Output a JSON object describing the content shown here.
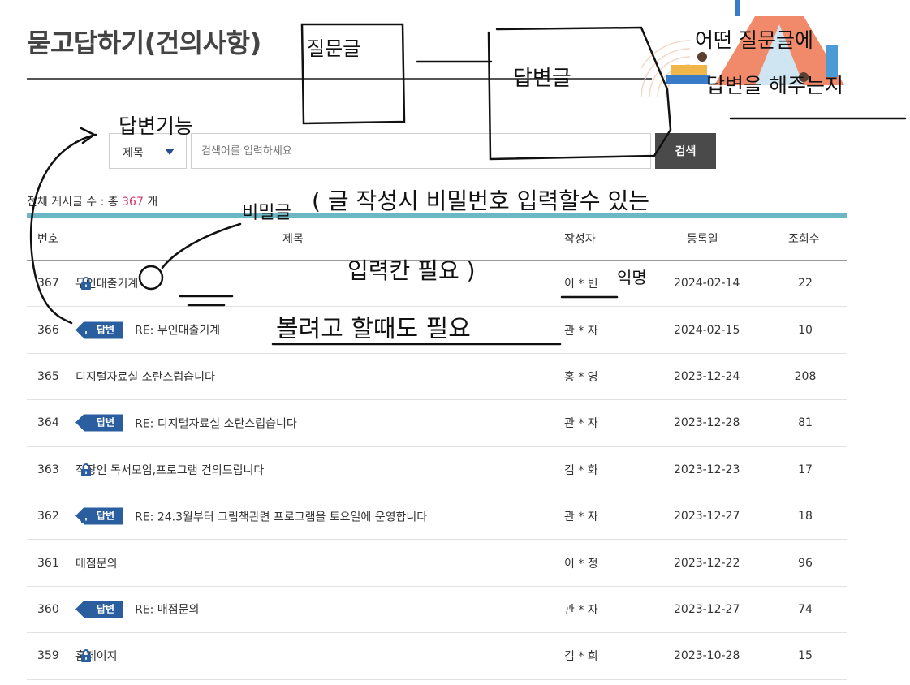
{
  "page": {
    "title": "묻고답하기(건의사항)"
  },
  "search": {
    "select_value": "제목",
    "placeholder": "검색어를 입력하세요",
    "button_label": "검색"
  },
  "summary": {
    "prefix": "전체 게시글 수 : 총",
    "count": "367",
    "suffix": "개"
  },
  "table": {
    "headers": [
      "번호",
      "제목",
      "작성자",
      "등록일",
      "조회수"
    ],
    "reply_badge": "답변",
    "rows": [
      {
        "num": "367",
        "reply": false,
        "title": "무인대출기계",
        "lock": true,
        "author": "이 * 빈",
        "date": "2024-02-14",
        "views": "22"
      },
      {
        "num": "366",
        "reply": true,
        "title": "RE: 무인대출기계",
        "lock": true,
        "author": "관 * 자",
        "date": "2024-02-15",
        "views": "10"
      },
      {
        "num": "365",
        "reply": false,
        "title": "디지털자료실 소란스럽습니다",
        "lock": false,
        "author": "홍 * 영",
        "date": "2023-12-24",
        "views": "208"
      },
      {
        "num": "364",
        "reply": true,
        "title": "RE: 디지털자료실 소란스럽습니다",
        "lock": false,
        "author": "관 * 자",
        "date": "2023-12-28",
        "views": "81"
      },
      {
        "num": "363",
        "reply": false,
        "title": "직장인 독서모임,프로그램 건의드립니다",
        "lock": true,
        "author": "김 * 화",
        "date": "2023-12-23",
        "views": "17"
      },
      {
        "num": "362",
        "reply": true,
        "title": "RE: 24.3월부터 그림책관련 프로그램을 토요일에 운영합니다",
        "lock": true,
        "author": "관 * 자",
        "date": "2023-12-27",
        "views": "18"
      },
      {
        "num": "361",
        "reply": false,
        "title": "매점문의",
        "lock": false,
        "author": "이 * 정",
        "date": "2023-12-22",
        "views": "96"
      },
      {
        "num": "360",
        "reply": true,
        "title": "RE: 매점문의",
        "lock": false,
        "author": "관 * 자",
        "date": "2023-12-27",
        "views": "74"
      },
      {
        "num": "359",
        "reply": false,
        "title": "홈페이지",
        "lock": true,
        "author": "김 * 희",
        "date": "2023-10-28",
        "views": "15"
      }
    ]
  },
  "annotations": {
    "question_post": "질문글",
    "answer_post": "답변글",
    "answer_note_line1": "어떤 질문글에",
    "answer_note_line2": "답변을 해주는지",
    "answer_feature": "답변기능",
    "secret_post": "비밀글",
    "secret_note_line1": "( 글 작성시 비밀번호 입력할수 있는",
    "secret_note_line2": "입력칸 필요 )",
    "view_note": "볼려고 할때도 필요",
    "anonymous": "익명"
  },
  "colors": {
    "accent_teal": "#6bb8c4",
    "reply_badge_blue": "#2a5e9f",
    "count_pink": "#d6336c",
    "search_button": "#4a4a4a"
  }
}
